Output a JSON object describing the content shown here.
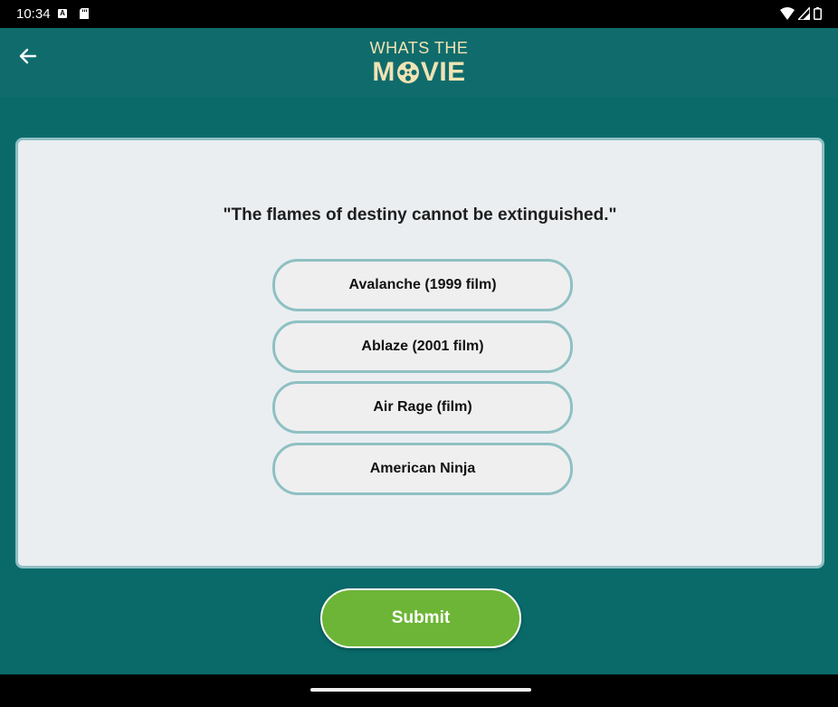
{
  "status_bar": {
    "time": "10:34",
    "left_icons": [
      "a-notification-icon",
      "sd-card-icon"
    ],
    "right_icons": [
      "wifi-icon",
      "signal-icon",
      "battery-icon"
    ]
  },
  "app_bar": {
    "back_icon": "arrow-left-icon",
    "logo_top": "WHATS THE",
    "logo_bottom_prefix": "M",
    "logo_bottom_suffix": "VIE",
    "logo_o_icon": "film-reel-icon"
  },
  "quiz": {
    "question": "\"The flames of destiny cannot be extinguished.\"",
    "options": [
      {
        "label": "Avalanche (1999 film)"
      },
      {
        "label": "Ablaze (2001 film)"
      },
      {
        "label": "Air Rage (film)"
      },
      {
        "label": "American Ninja"
      }
    ]
  },
  "submit": {
    "label": "Submit"
  },
  "colors": {
    "background": "#0a6a6a",
    "app_bar": "#106c6c",
    "logo": "#f1e3b4",
    "card": "#eaeef1",
    "border": "#8fc0c3",
    "submit": "#6db536"
  }
}
